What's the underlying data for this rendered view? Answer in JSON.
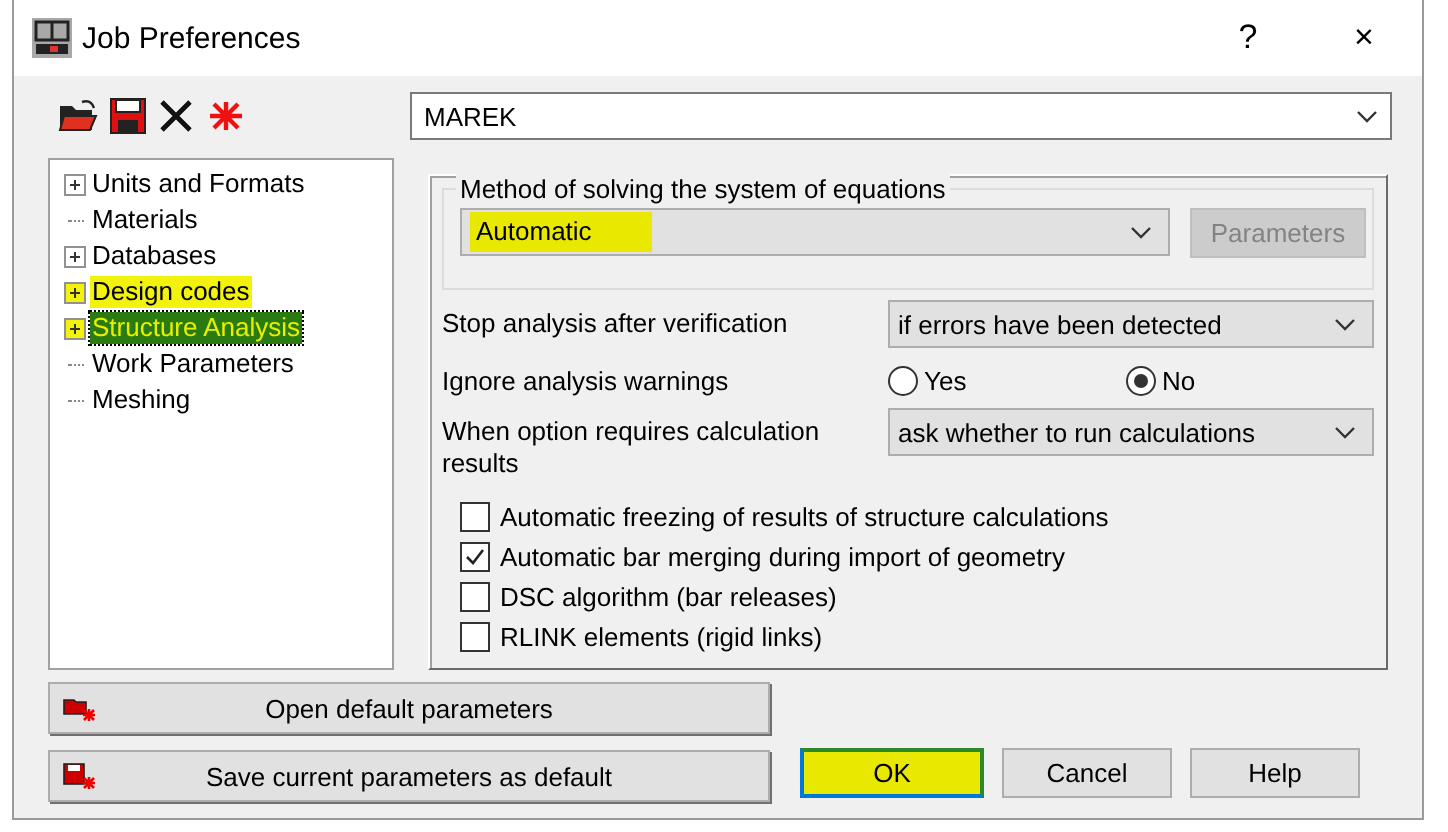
{
  "window": {
    "title": "Job Preferences",
    "help_button": "?",
    "close_button": "×"
  },
  "job_name": {
    "value": "MAREK"
  },
  "tree": {
    "items": [
      {
        "label": "Units and Formats",
        "expandable": true,
        "selected": false,
        "highlighted": false
      },
      {
        "label": "Materials",
        "expandable": false,
        "selected": false,
        "highlighted": false
      },
      {
        "label": "Databases",
        "expandable": true,
        "selected": false,
        "highlighted": false
      },
      {
        "label": "Design codes",
        "expandable": true,
        "selected": false,
        "highlighted": true
      },
      {
        "label": "Structure Analysis",
        "expandable": true,
        "selected": true,
        "highlighted": true
      },
      {
        "label": "Work Parameters",
        "expandable": false,
        "selected": false,
        "highlighted": false
      },
      {
        "label": "Meshing",
        "expandable": false,
        "selected": false,
        "highlighted": false
      }
    ]
  },
  "analysis": {
    "method": {
      "label": "Method of solving the system of equations",
      "value": "Automatic",
      "highlighted": true
    },
    "parameters_button": {
      "label": "Parameters",
      "disabled": true
    },
    "settings": [
      {
        "kind": "dropdown",
        "label": "Stop analysis after verification",
        "value": "if errors have been detected"
      },
      {
        "kind": "radio",
        "label": "Ignore analysis warnings",
        "options": [
          {
            "label": "Yes",
            "selected": false
          },
          {
            "label": "No",
            "selected": true
          }
        ]
      },
      {
        "kind": "dropdown",
        "label": "When option requires calculation results",
        "value": "ask whether to run calculations"
      }
    ],
    "checkboxes": [
      {
        "label": "Automatic freezing of results of structure calculations",
        "checked": false
      },
      {
        "label": "Automatic bar merging during import of geometry",
        "checked": true
      },
      {
        "label": "DSC algorithm (bar releases)",
        "checked": false
      },
      {
        "label": "RLINK elements (rigid links)",
        "checked": false
      }
    ]
  },
  "buttons": {
    "left": [
      {
        "kind": "open",
        "label": "Open default parameters"
      },
      {
        "kind": "save",
        "label": "Save current parameters as default"
      }
    ],
    "dialog": [
      {
        "label": "OK",
        "default": true,
        "highlighted": true
      },
      {
        "label": "Cancel",
        "default": false,
        "highlighted": false
      },
      {
        "label": "Help",
        "default": false,
        "highlighted": false
      }
    ]
  }
}
